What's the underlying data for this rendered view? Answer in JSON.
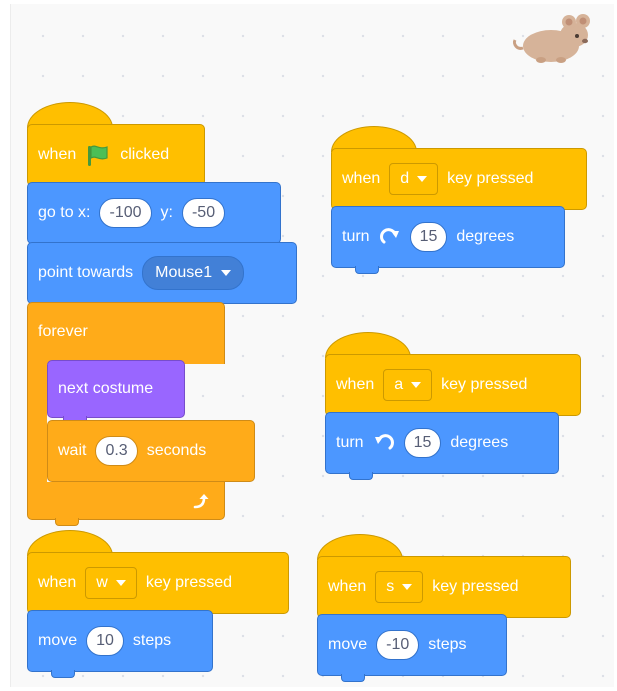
{
  "workspace": {
    "sprite_icon": "mouse-sprite-icon"
  },
  "script_green_flag": {
    "hat": {
      "when": "when",
      "icon": "green-flag-icon",
      "clicked": "clicked"
    },
    "goto": {
      "label_x": "go to x:",
      "x": "-100",
      "label_y": "y:",
      "y": "-50"
    },
    "point": {
      "label": "point towards",
      "target": "Mouse1"
    },
    "forever": {
      "label": "forever",
      "loop_icon": "loop-arrow-icon"
    },
    "next_costume": {
      "label": "next costume"
    },
    "wait": {
      "label": "wait",
      "value": "0.3",
      "unit": "seconds"
    }
  },
  "script_key_d": {
    "hat": {
      "when": "when",
      "key": "d",
      "pressed": "key pressed"
    },
    "turn": {
      "label": "turn",
      "icon": "rotate-right-icon",
      "value": "15",
      "unit": "degrees"
    }
  },
  "script_key_a": {
    "hat": {
      "when": "when",
      "key": "a",
      "pressed": "key pressed"
    },
    "turn": {
      "label": "turn",
      "icon": "rotate-left-icon",
      "value": "15",
      "unit": "degrees"
    }
  },
  "script_key_w": {
    "hat": {
      "when": "when",
      "key": "w",
      "pressed": "key pressed"
    },
    "move": {
      "label": "move",
      "value": "10",
      "unit": "steps"
    }
  },
  "script_key_s": {
    "hat": {
      "when": "when",
      "key": "s",
      "pressed": "key pressed"
    },
    "move": {
      "label": "move",
      "value": "-10",
      "unit": "steps"
    }
  },
  "colors": {
    "events": "#ffbf00",
    "motion": "#4c97ff",
    "control": "#ffab19",
    "looks": "#9966ff",
    "workspace": "#f9f9f9"
  }
}
